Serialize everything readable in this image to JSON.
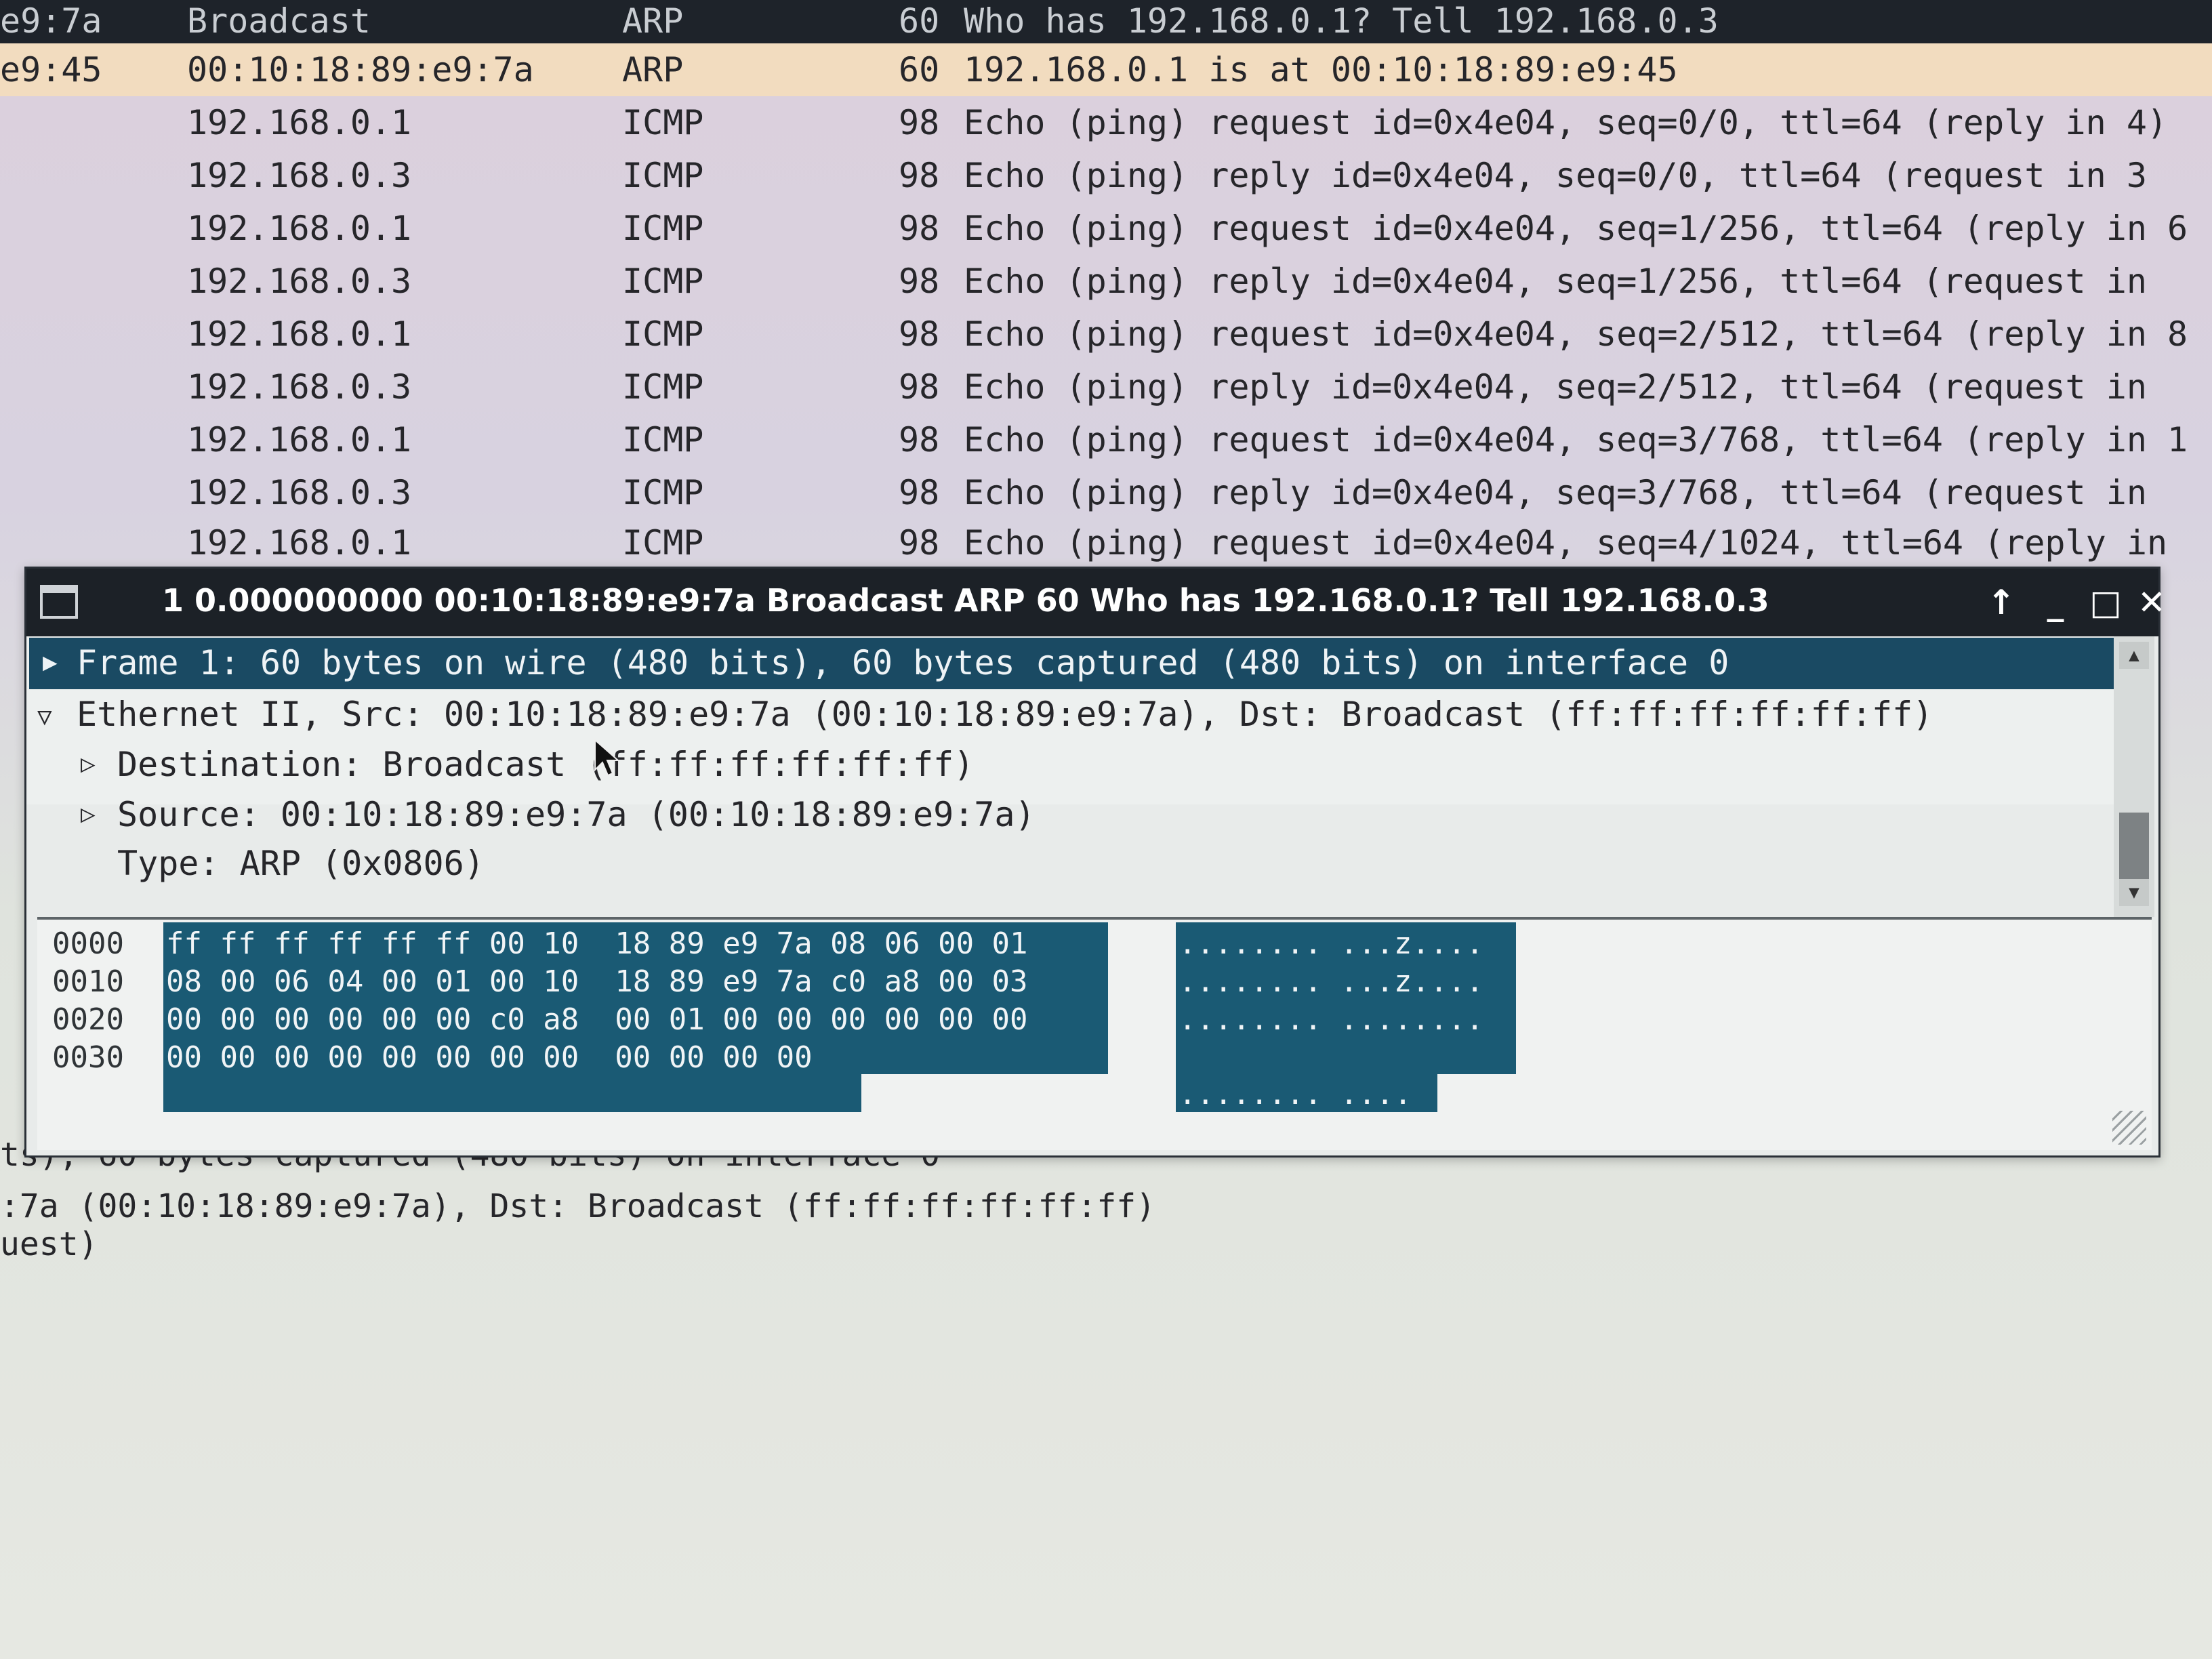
{
  "packet_list": {
    "rows": [
      {
        "src": "e9:7a",
        "dst": "Broadcast",
        "protocol": "ARP",
        "length": "60",
        "info": "Who has 192.168.0.1?  Tell 192.168.0.3"
      },
      {
        "src": "e9:45",
        "dst": "00:10:18:89:e9:7a",
        "protocol": "ARP",
        "length": "60",
        "info": "192.168.0.1 is at 00:10:18:89:e9:45"
      },
      {
        "src": "",
        "dst": "192.168.0.1",
        "protocol": "ICMP",
        "length": "98",
        "info": "Echo (ping) request  id=0x4e04, seq=0/0, ttl=64 (reply in 4)"
      },
      {
        "src": "",
        "dst": "192.168.0.3",
        "protocol": "ICMP",
        "length": "98",
        "info": "Echo (ping) reply    id=0x4e04, seq=0/0, ttl=64 (request in 3"
      },
      {
        "src": "",
        "dst": "192.168.0.1",
        "protocol": "ICMP",
        "length": "98",
        "info": "Echo (ping) request  id=0x4e04, seq=1/256, ttl=64 (reply in 6"
      },
      {
        "src": "",
        "dst": "192.168.0.3",
        "protocol": "ICMP",
        "length": "98",
        "info": "Echo (ping) reply    id=0x4e04, seq=1/256, ttl=64 (request in"
      },
      {
        "src": "",
        "dst": "192.168.0.1",
        "protocol": "ICMP",
        "length": "98",
        "info": "Echo (ping) request  id=0x4e04, seq=2/512, ttl=64 (reply in 8"
      },
      {
        "src": "",
        "dst": "192.168.0.3",
        "protocol": "ICMP",
        "length": "98",
        "info": "Echo (ping) reply    id=0x4e04, seq=2/512, ttl=64 (request in"
      },
      {
        "src": "",
        "dst": "192.168.0.1",
        "protocol": "ICMP",
        "length": "98",
        "info": "Echo (ping) request  id=0x4e04, seq=3/768, ttl=64 (reply in 1"
      },
      {
        "src": "",
        "dst": "192.168.0.3",
        "protocol": "ICMP",
        "length": "98",
        "info": "Echo (ping) reply    id=0x4e04, seq=3/768, ttl=64 (request in"
      },
      {
        "src": "",
        "dst": "192.168.0.1",
        "protocol": "ICMP",
        "length": "98",
        "info": "Echo (ping) request  id=0x4e04, seq=4/1024, ttl=64 (reply in"
      }
    ]
  },
  "packet_window": {
    "title": "1 0.000000000 00:10:18:89:e9:7a Broadcast ARP 60 Who has 192.168.0.1?  Tell 192.168.0.3",
    "buttons": {
      "up": "↑",
      "minimize": "_",
      "maximize": "□",
      "close": "✕"
    },
    "tree": {
      "frame": "Frame 1: 60 bytes on wire (480 bits), 60 bytes captured (480 bits) on interface 0",
      "ethernet": "Ethernet II, Src: 00:10:18:89:e9:7a (00:10:18:89:e9:7a), Dst: Broadcast (ff:ff:ff:ff:ff:ff)",
      "destination": "Destination: Broadcast (ff:ff:ff:ff:ff:ff)",
      "source": "Source: 00:10:18:89:e9:7a (00:10:18:89:e9:7a)",
      "type": "Type: ARP (0x0806)"
    },
    "hex": {
      "rows": [
        {
          "offset": "0000",
          "bytes": "ff ff ff ff ff ff 00 10  18 89 e9 7a 08 06 00 01",
          "ascii": "........ ...z...."
        },
        {
          "offset": "0010",
          "bytes": "08 00 06 04 00 01 00 10  18 89 e9 7a c0 a8 00 03",
          "ascii": "........ ...z...."
        },
        {
          "offset": "0020",
          "bytes": "00 00 00 00 00 00 c0 a8  00 01 00 00 00 00 00 00",
          "ascii": "........ ........"
        },
        {
          "offset": "0030",
          "bytes": "00 00 00 00 00 00 00 00  00 00 00 00",
          "ascii": "........ ...."
        }
      ]
    }
  },
  "background_detail": {
    "line1": "ts), 60 bytes captured (480 bits) on interface 0",
    "line2": ":7a (00:10:18:89:e9:7a), Dst: Broadcast (ff:ff:ff:ff:ff:ff)",
    "line3": "uest)"
  },
  "colors": {
    "selection": "#1a4a63",
    "hex_highlight": "#1a5a74",
    "title_bar": "#1c2127",
    "selected_packet_row": "#f2dcbf"
  }
}
